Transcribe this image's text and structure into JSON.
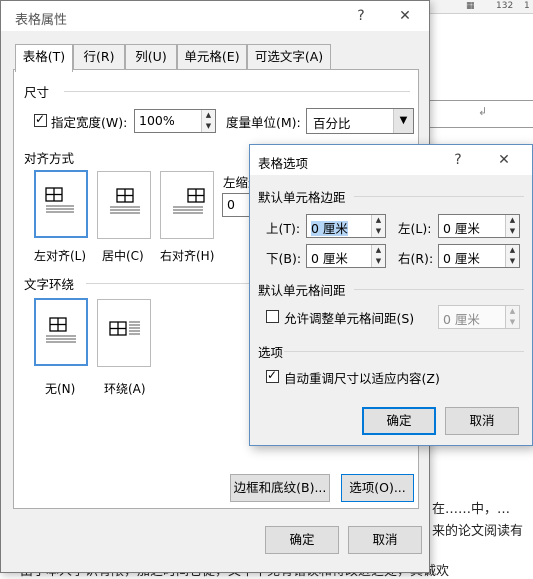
{
  "ruler": {
    "marks": [
      "▦",
      "132",
      "1"
    ]
  },
  "background_doc": {
    "cell_mark": "↲",
    "texts": {
      "line1": "在……中，…",
      "line2": "来的论文阅读有",
      "line3": "由于本人学识有限，加之时间仓促，文中不免有错误和待改进之处，真诚欢"
    }
  },
  "table_properties": {
    "title": "表格属性",
    "help": "?",
    "close": "✕",
    "tabs": [
      "表格(T)",
      "行(R)",
      "列(U)",
      "单元格(E)",
      "可选文字(A)"
    ],
    "size": {
      "heading": "尺寸",
      "specify_width_label": "指定宽度(W):",
      "specify_width_checked": true,
      "width_value": "100%",
      "unit_label": "度量单位(M):",
      "unit_value": "百分比"
    },
    "alignment": {
      "heading": "对齐方式",
      "left": "左对齐(L)",
      "center": "居中(C)",
      "right": "右对齐(H)",
      "indent_label": "左缩进",
      "indent_value": "0",
      "selected": "left"
    },
    "wrapping": {
      "heading": "文字环绕",
      "none": "无(N)",
      "around": "环绕(A)",
      "selected": "none"
    },
    "buttons": {
      "borders": "边框和底纹(B)...",
      "options": "选项(O)...",
      "ok": "确定",
      "cancel": "取消"
    }
  },
  "table_options": {
    "title": "表格选项",
    "help": "?",
    "close": "✕",
    "default_margins": {
      "heading": "默认单元格边距",
      "top_label": "上(T):",
      "top_value": "0 厘米",
      "left_label": "左(L):",
      "left_value": "0 厘米",
      "bottom_label": "下(B):",
      "bottom_value": "0 厘米",
      "right_label": "右(R):",
      "right_value": "0 厘米"
    },
    "default_spacing": {
      "heading": "默认单元格间距",
      "allow_label": "允许调整单元格间距(S)",
      "allow_checked": false,
      "spacing_value": "0 厘米"
    },
    "options": {
      "heading": "选项",
      "autoresize_label": "自动重调尺寸以适应内容(Z)",
      "autoresize_checked": true
    },
    "buttons": {
      "ok": "确定",
      "cancel": "取消"
    }
  }
}
